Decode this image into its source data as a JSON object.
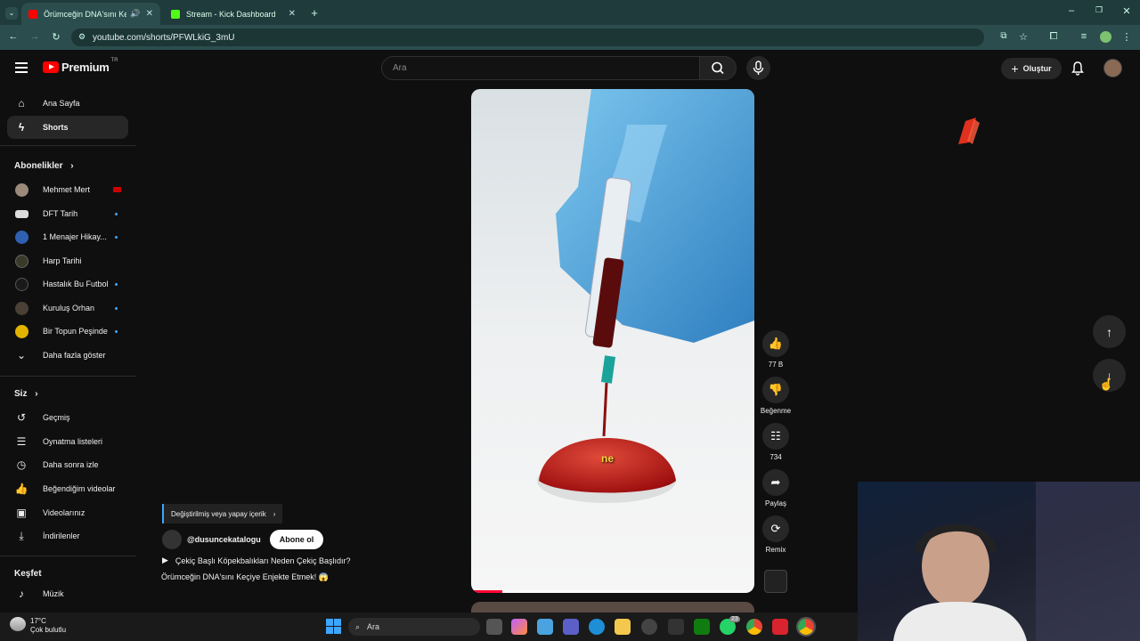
{
  "browser": {
    "tabs": [
      {
        "title": "Örümceğin DNA'sını Keçiye",
        "active": true,
        "color": "#ff0000"
      },
      {
        "title": "Stream - Kick Dashboard",
        "active": false,
        "color": "#53fc18"
      }
    ],
    "url": "youtube.com/shorts/PFWLkiG_3mU"
  },
  "header": {
    "brand": "Premium",
    "region": "TR",
    "search_placeholder": "Ara",
    "create_label": "Oluştur"
  },
  "sidebar": {
    "main": [
      {
        "label": "Ana Sayfa",
        "icon": "home-icon"
      },
      {
        "label": "Shorts",
        "icon": "shorts-icon"
      }
    ],
    "subscriptions_title": "Abonelikler",
    "subscriptions": [
      {
        "label": "Mehmet Mert",
        "status": "live"
      },
      {
        "label": "DFT Tarih",
        "status": "new"
      },
      {
        "label": "1 Menajer Hikay...",
        "status": "new"
      },
      {
        "label": "Harp Tarihi",
        "status": ""
      },
      {
        "label": "Hastalık Bu Futbol",
        "status": "new"
      },
      {
        "label": "Kuruluş Orhan",
        "status": "new"
      },
      {
        "label": "Bir Topun Peşinde",
        "status": "new"
      }
    ],
    "show_more": "Daha fazla göster",
    "you_title": "Siz",
    "you": [
      {
        "label": "Geçmiş",
        "icon": "history-icon"
      },
      {
        "label": "Oynatma listeleri",
        "icon": "playlist-icon"
      },
      {
        "label": "Daha sonra izle",
        "icon": "clock-icon"
      },
      {
        "label": "Beğendiğim videolar",
        "icon": "like-icon"
      },
      {
        "label": "Videolarınız",
        "icon": "video-icon"
      },
      {
        "label": "İndirilenler",
        "icon": "download-icon"
      }
    ],
    "explore_title": "Keşfet",
    "explore": [
      {
        "label": "Müzik",
        "icon": "music-icon"
      }
    ]
  },
  "short": {
    "overlay_caption": "ne",
    "progress": 0.11,
    "badge": "Değiştirilmiş veya yapay içerik",
    "channel": "@dusuncekatalogu",
    "subscribe_label": "Abone ol",
    "related": "Çekiç Başlı Köpekbalıkları Neden Çekiç Başlıdır?",
    "title": "Örümceğin DNA'sını Keçiye Enjekte Etmek! 😱",
    "actions": {
      "likes": "77 B",
      "dislike": "Beğenme",
      "comments": "734",
      "share": "Paylaş",
      "remix": "Remix"
    }
  },
  "taskbar": {
    "weather_temp": "17°C",
    "weather_desc": "Çok bulutlu",
    "search": "Ara",
    "whatsapp_badge": "23"
  }
}
